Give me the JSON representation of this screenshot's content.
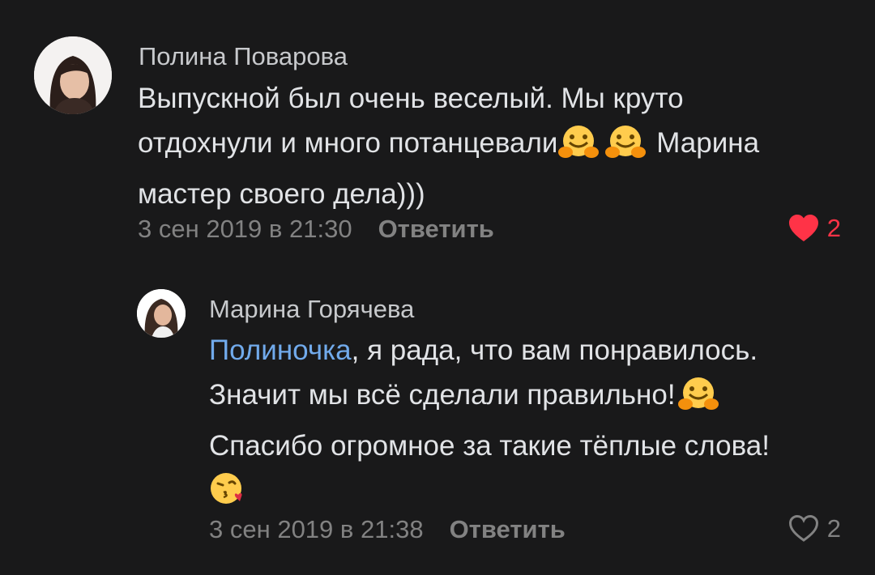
{
  "comments": [
    {
      "author": "Полина Поварова",
      "text_line1": "Выпускной был очень веселый. Мы круто",
      "text_line2a": "отдохнули и много потанцевали",
      "text_line2b": "Марина",
      "text_line3": "мастер своего дела)))",
      "timestamp": "3 сен 2019 в 21:30",
      "reply_label": "Ответить",
      "likes": "2",
      "liked": true,
      "emojis": [
        "hugging-face",
        "hugging-face"
      ]
    }
  ],
  "reply": {
    "author": "Марина Горячева",
    "mention": "Полиночка",
    "text_line1_rest": ", я рада, что вам понравилось.",
    "text_line2": "Значит мы всё сделали правильно!",
    "text_line3": "Спасибо огромное за такие тёплые слова!",
    "timestamp": "3 сен 2019 в 21:38",
    "reply_label": "Ответить",
    "likes": "2",
    "liked": false,
    "emojis": [
      "hugging-face",
      "face-blowing-kiss"
    ]
  },
  "colors": {
    "background": "#19191a",
    "text": "#e1e3e6",
    "secondary": "#828282",
    "mention": "#71aaeb",
    "like_active": "#ff3347"
  }
}
